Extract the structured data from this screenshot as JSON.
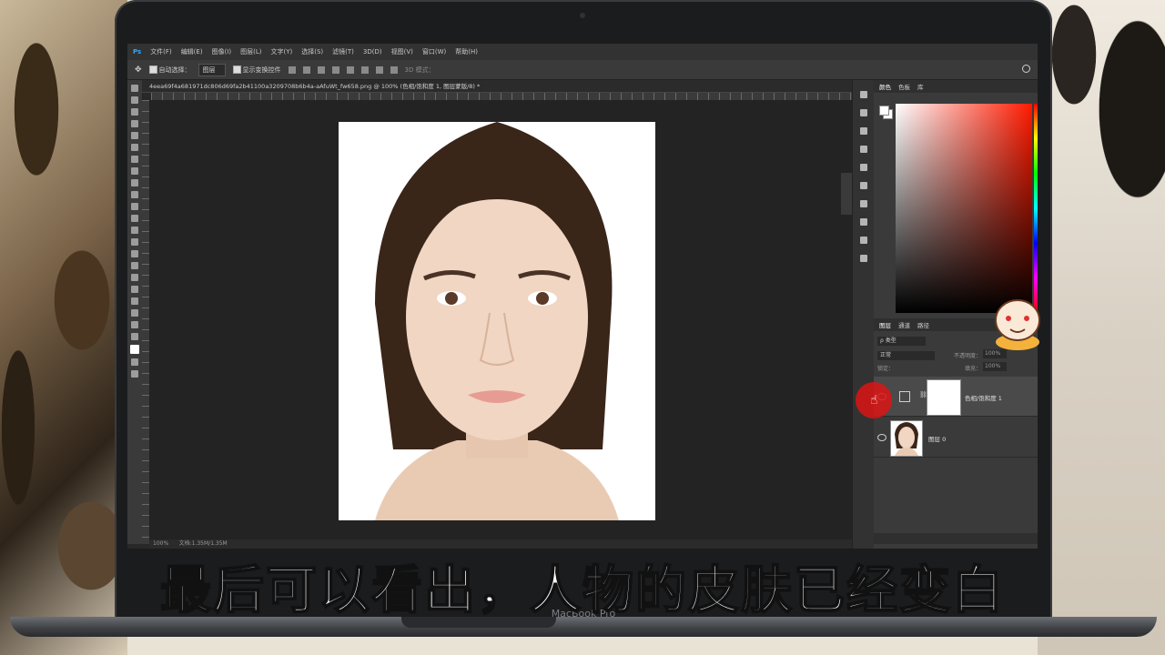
{
  "menu": [
    "文件(F)",
    "编辑(E)",
    "图像(I)",
    "图层(L)",
    "文字(Y)",
    "选择(S)",
    "滤镜(T)",
    "3D(D)",
    "视图(V)",
    "窗口(W)",
    "帮助(H)"
  ],
  "options_bar": {
    "auto_select_label": "自动选择：",
    "auto_select_target": "图层",
    "show_transform_label": "显示变换控件",
    "mode_3d_label": "3D 模式："
  },
  "document_tab": "4eea69f4a681971dc806d69fa2b41100a3209708b6b4a-aAfuWt_fw658.png @ 100% (色相/饱和度 1, 图层蒙版/8) *",
  "status": {
    "zoom": "100%",
    "doc_size": "文档:1.35M/1.35M"
  },
  "color_panel": {
    "tabs": [
      "颜色",
      "色板",
      "库"
    ],
    "active_hex": "#ff1a00"
  },
  "layers_panel": {
    "tabs": [
      "图层",
      "通道",
      "路径"
    ],
    "filter": "类型",
    "blend_mode": "正常",
    "opacity_label": "不透明度：",
    "opacity_value": "100%",
    "lock_label": "锁定：",
    "fill_label": "填充：",
    "fill_value": "100%",
    "layers": [
      {
        "name": "色相/饱和度 1",
        "type": "adjustment",
        "active": true
      },
      {
        "name": "图层 0",
        "type": "image",
        "active": false
      }
    ]
  },
  "laptop_brand": "MacBook Pro",
  "subtitle": "最后可以看出，人物的皮肤已经变白"
}
